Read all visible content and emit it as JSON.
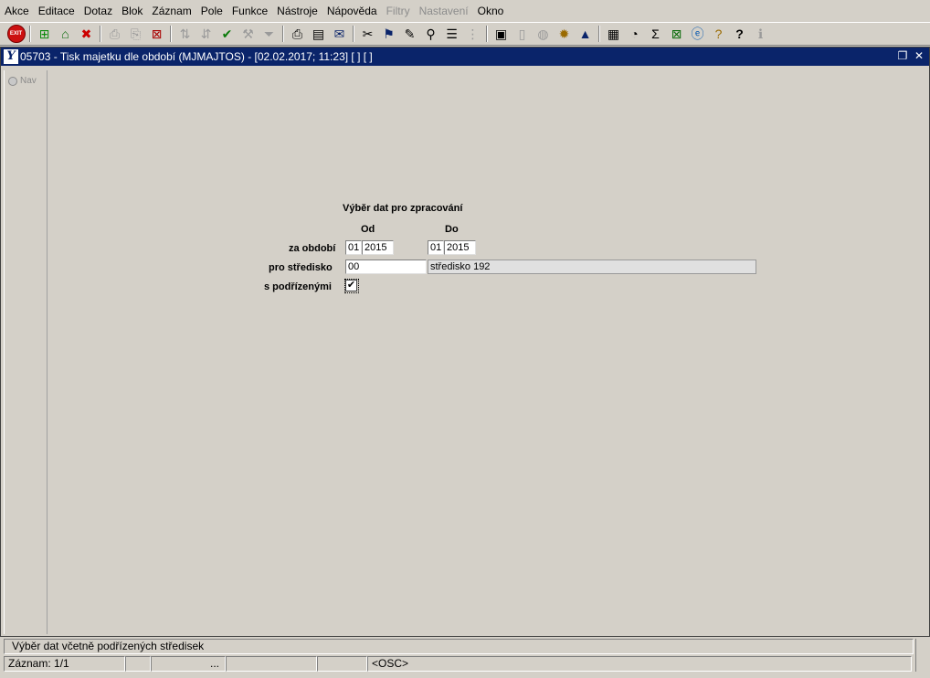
{
  "menu": [
    "Akce",
    "Editace",
    "Dotaz",
    "Blok",
    "Záznam",
    "Pole",
    "Funkce",
    "Nástroje",
    "Nápověda",
    "Filtry",
    "Nastavení",
    "Okno"
  ],
  "menu_disabled": [
    "Filtry",
    "Nastavení"
  ],
  "window": {
    "title": "05703 - Tisk majetku dle období (MJMAJTOS) - [02.02.2017; 11:23]  [ ]  [ ]",
    "icon_letter": "Y"
  },
  "nav": {
    "label": "Nav"
  },
  "form": {
    "heading": "Výběr dat pro zpracování",
    "col_from": "Od",
    "col_to": "Do",
    "period_label": "za období",
    "from_month": "01",
    "from_year": "2015",
    "to_month": "01",
    "to_year": "2015",
    "center_label": "pro středisko",
    "center_code": "00",
    "center_name": "středisko 192",
    "subordinates_label": "s podřízenými",
    "subordinates_checked": true,
    "check_mark": "✔"
  },
  "status": {
    "hint": "Výběr dat včetně podřízených středisek",
    "record": "Záznam: 1/1",
    "cell3": "",
    "cell4": "...",
    "cell5": "",
    "cell6": "",
    "mode": "<OSC>"
  }
}
